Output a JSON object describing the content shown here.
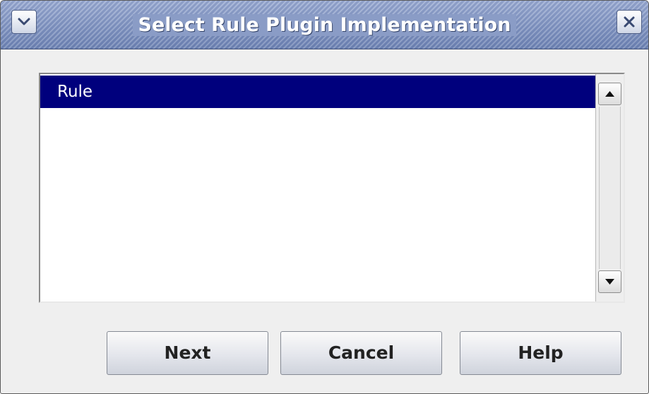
{
  "window": {
    "title": "Select Rule Plugin Implementation",
    "menu_icon": "chevron-down-icon",
    "close_icon": "close-icon"
  },
  "list": {
    "items": [
      {
        "label": "Rule",
        "selected": true
      }
    ],
    "scroll_up_icon": "triangle-up-icon",
    "scroll_down_icon": "triangle-down-icon"
  },
  "buttons": {
    "next_label": "Next",
    "cancel_label": "Cancel",
    "help_label": "Help"
  },
  "colors": {
    "titlebar": "#8497c1",
    "selection": "#00007d",
    "background": "#efefef"
  }
}
